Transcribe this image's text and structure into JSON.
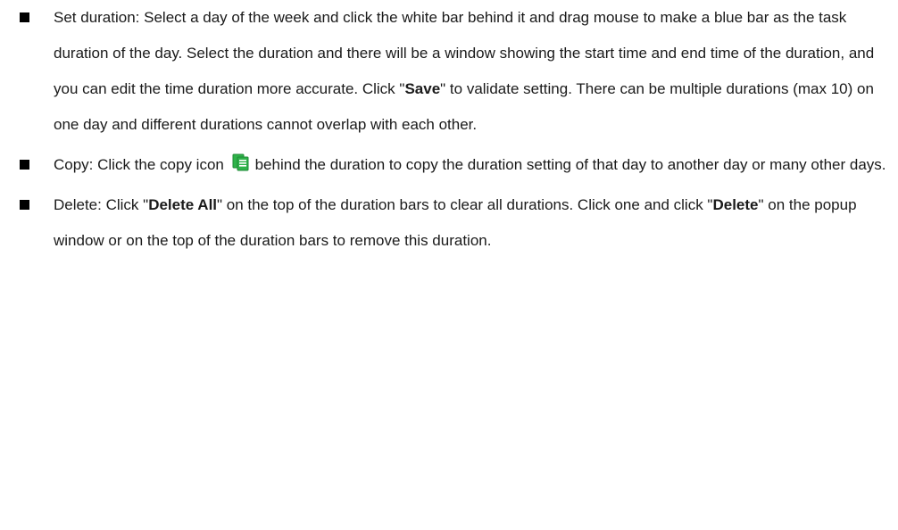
{
  "items": [
    {
      "segments": [
        {
          "text": "Set duration: Select a day of the week and click the white bar behind it and drag mouse to make a blue bar as the task duration of the day. Select the duration and there will be a window showing the start time and end time of the duration, and you can edit the time duration more accurate. Click \"",
          "bold": false
        },
        {
          "text": "Save",
          "bold": true
        },
        {
          "text": "\" to validate setting. There can be multiple durations (max 10) on one day and different durations cannot overlap with each other.",
          "bold": false
        }
      ]
    },
    {
      "segments": [
        {
          "text": "Copy: Click the copy icon ",
          "bold": false
        },
        {
          "icon": "copy-icon"
        },
        {
          "text": "behind the duration to copy the duration setting of that day to another day or many other days.",
          "bold": false
        }
      ]
    },
    {
      "segments": [
        {
          "text": "Delete: Click \"",
          "bold": false
        },
        {
          "text": "Delete All",
          "bold": true
        },
        {
          "text": "\" on the top of the duration bars to clear all durations. Click one and click \"",
          "bold": false
        },
        {
          "text": "Delete",
          "bold": true
        },
        {
          "text": "\" on the popup window or on the top of the duration bars to remove this duration.",
          "bold": false
        }
      ]
    }
  ],
  "colors": {
    "bullet": "#000000",
    "icon_green": "#2fb34a",
    "icon_green_dark": "#1e8a34",
    "icon_page": "#ffffff"
  }
}
